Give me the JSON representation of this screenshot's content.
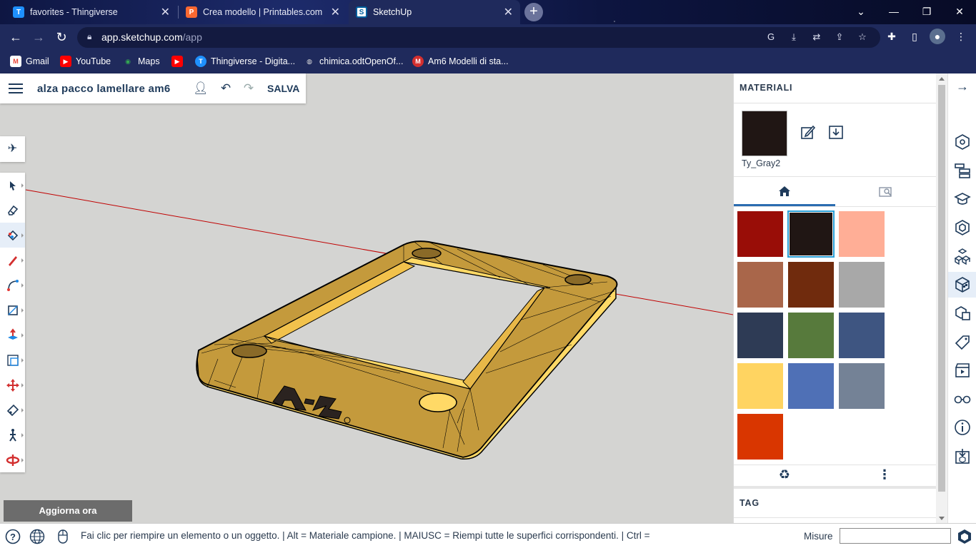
{
  "browser": {
    "tabs": [
      {
        "title": "favorites - Thingiverse",
        "favicon": "T",
        "favicon_color": "#1e90ff",
        "active": false
      },
      {
        "title": "Crea modello | Printables.com",
        "favicon": "P",
        "favicon_color": "#fa6831",
        "active": false
      },
      {
        "title": "SketchUp",
        "favicon": "S",
        "favicon_color": "#005f9e",
        "active": true
      }
    ],
    "url_host": "app.sketchup.com",
    "url_path": "/app",
    "bookmarks": [
      {
        "label": "Gmail",
        "icon": "M",
        "color": "#ea4335"
      },
      {
        "label": "YouTube",
        "icon": "▶",
        "color": "#ff0000"
      },
      {
        "label": "Maps",
        "icon": "◉",
        "color": "#34a853"
      },
      {
        "label": "",
        "icon": "▶",
        "color": "#ff0000"
      },
      {
        "label": "Thingiverse - Digita...",
        "icon": "T",
        "color": "#1e90ff"
      },
      {
        "label": "chimica.odtOpenOf...",
        "icon": "◍",
        "color": "#888888"
      },
      {
        "label": "Am6 Modelli di sta...",
        "icon": "M",
        "color": "#d32f2f"
      }
    ]
  },
  "app": {
    "model_title": "alza pacco lamellare am6",
    "save_label": "SALVA",
    "update_label": "Aggiorna ora",
    "status_hint": "Fai clic per riempire un elemento o un oggetto. | Alt = Materiale campione. | MAIUSC = Riempi tutte le superfici corrispondenti. | Ctrl =",
    "measure_label": "Misure",
    "measure_value": ""
  },
  "materials": {
    "title": "MATERIALI",
    "current_name": "Ty_Gray2",
    "current_color": "#201614",
    "swatches": [
      "#990d07",
      "#201614",
      "#ffae96",
      "#a9664a",
      "#702b0d",
      "#a8a8a8",
      "#2e3b55",
      "#577a3c",
      "#3e5581",
      "#ffd461",
      "#4f70b6",
      "#748296",
      "#d93600"
    ],
    "selected_index": 1,
    "tag_title": "TAG"
  },
  "colors": {
    "accent": "#2b6cb0",
    "model_yellow": "#f7c955",
    "model_yellow_dark": "#c49a3c",
    "axis_red": "#c00000"
  }
}
